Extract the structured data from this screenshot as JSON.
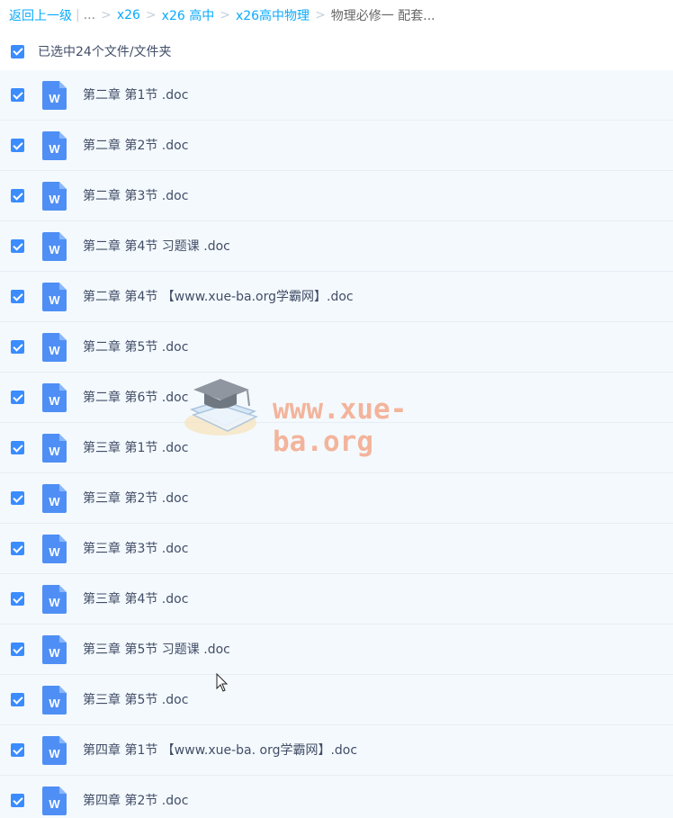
{
  "breadcrumb": {
    "back": "返回上一级",
    "divider": "|",
    "ellipsis": "...",
    "separator": ">",
    "items": [
      "x26",
      "x26 高中",
      "x26高中物理"
    ],
    "current": "物理必修一 配套..."
  },
  "selection": {
    "label": "已选中24个文件/文件夹",
    "checked": true
  },
  "file_icon_letter": "W",
  "files": [
    {
      "name": "第二章 第1节 .doc",
      "checked": true
    },
    {
      "name": "第二章 第2节 .doc",
      "checked": true
    },
    {
      "name": "第二章 第3节 .doc",
      "checked": true
    },
    {
      "name": "第二章 第4节 习题课 .doc",
      "checked": true
    },
    {
      "name": "第二章 第4节 【www.xue-ba.org学霸网】.doc",
      "checked": true
    },
    {
      "name": "第二章 第5节 .doc",
      "checked": true
    },
    {
      "name": "第二章 第6节 .doc",
      "checked": true
    },
    {
      "name": "第三章 第1节 .doc",
      "checked": true
    },
    {
      "name": "第三章 第2节 .doc",
      "checked": true
    },
    {
      "name": "第三章 第3节 .doc",
      "checked": true
    },
    {
      "name": "第三章 第4节 .doc",
      "checked": true
    },
    {
      "name": "第三章 第5节 习题课 .doc",
      "checked": true
    },
    {
      "name": "第三章 第5节 .doc",
      "checked": true
    },
    {
      "name": "第四章 第1节 【www.xue-ba. org学霸网】.doc",
      "checked": true
    },
    {
      "name": "第四章 第2节 .doc",
      "checked": true
    }
  ],
  "watermark": {
    "text": "www.xue-ba.org",
    "icon": "graduation-cap-book-logo"
  },
  "colors": {
    "link": "#09aaff",
    "checkbox": "#3b8cff",
    "doc_icon": "#4f8ff5",
    "list_bg": "#f4f9fd",
    "watermark": "#f3a98c"
  }
}
